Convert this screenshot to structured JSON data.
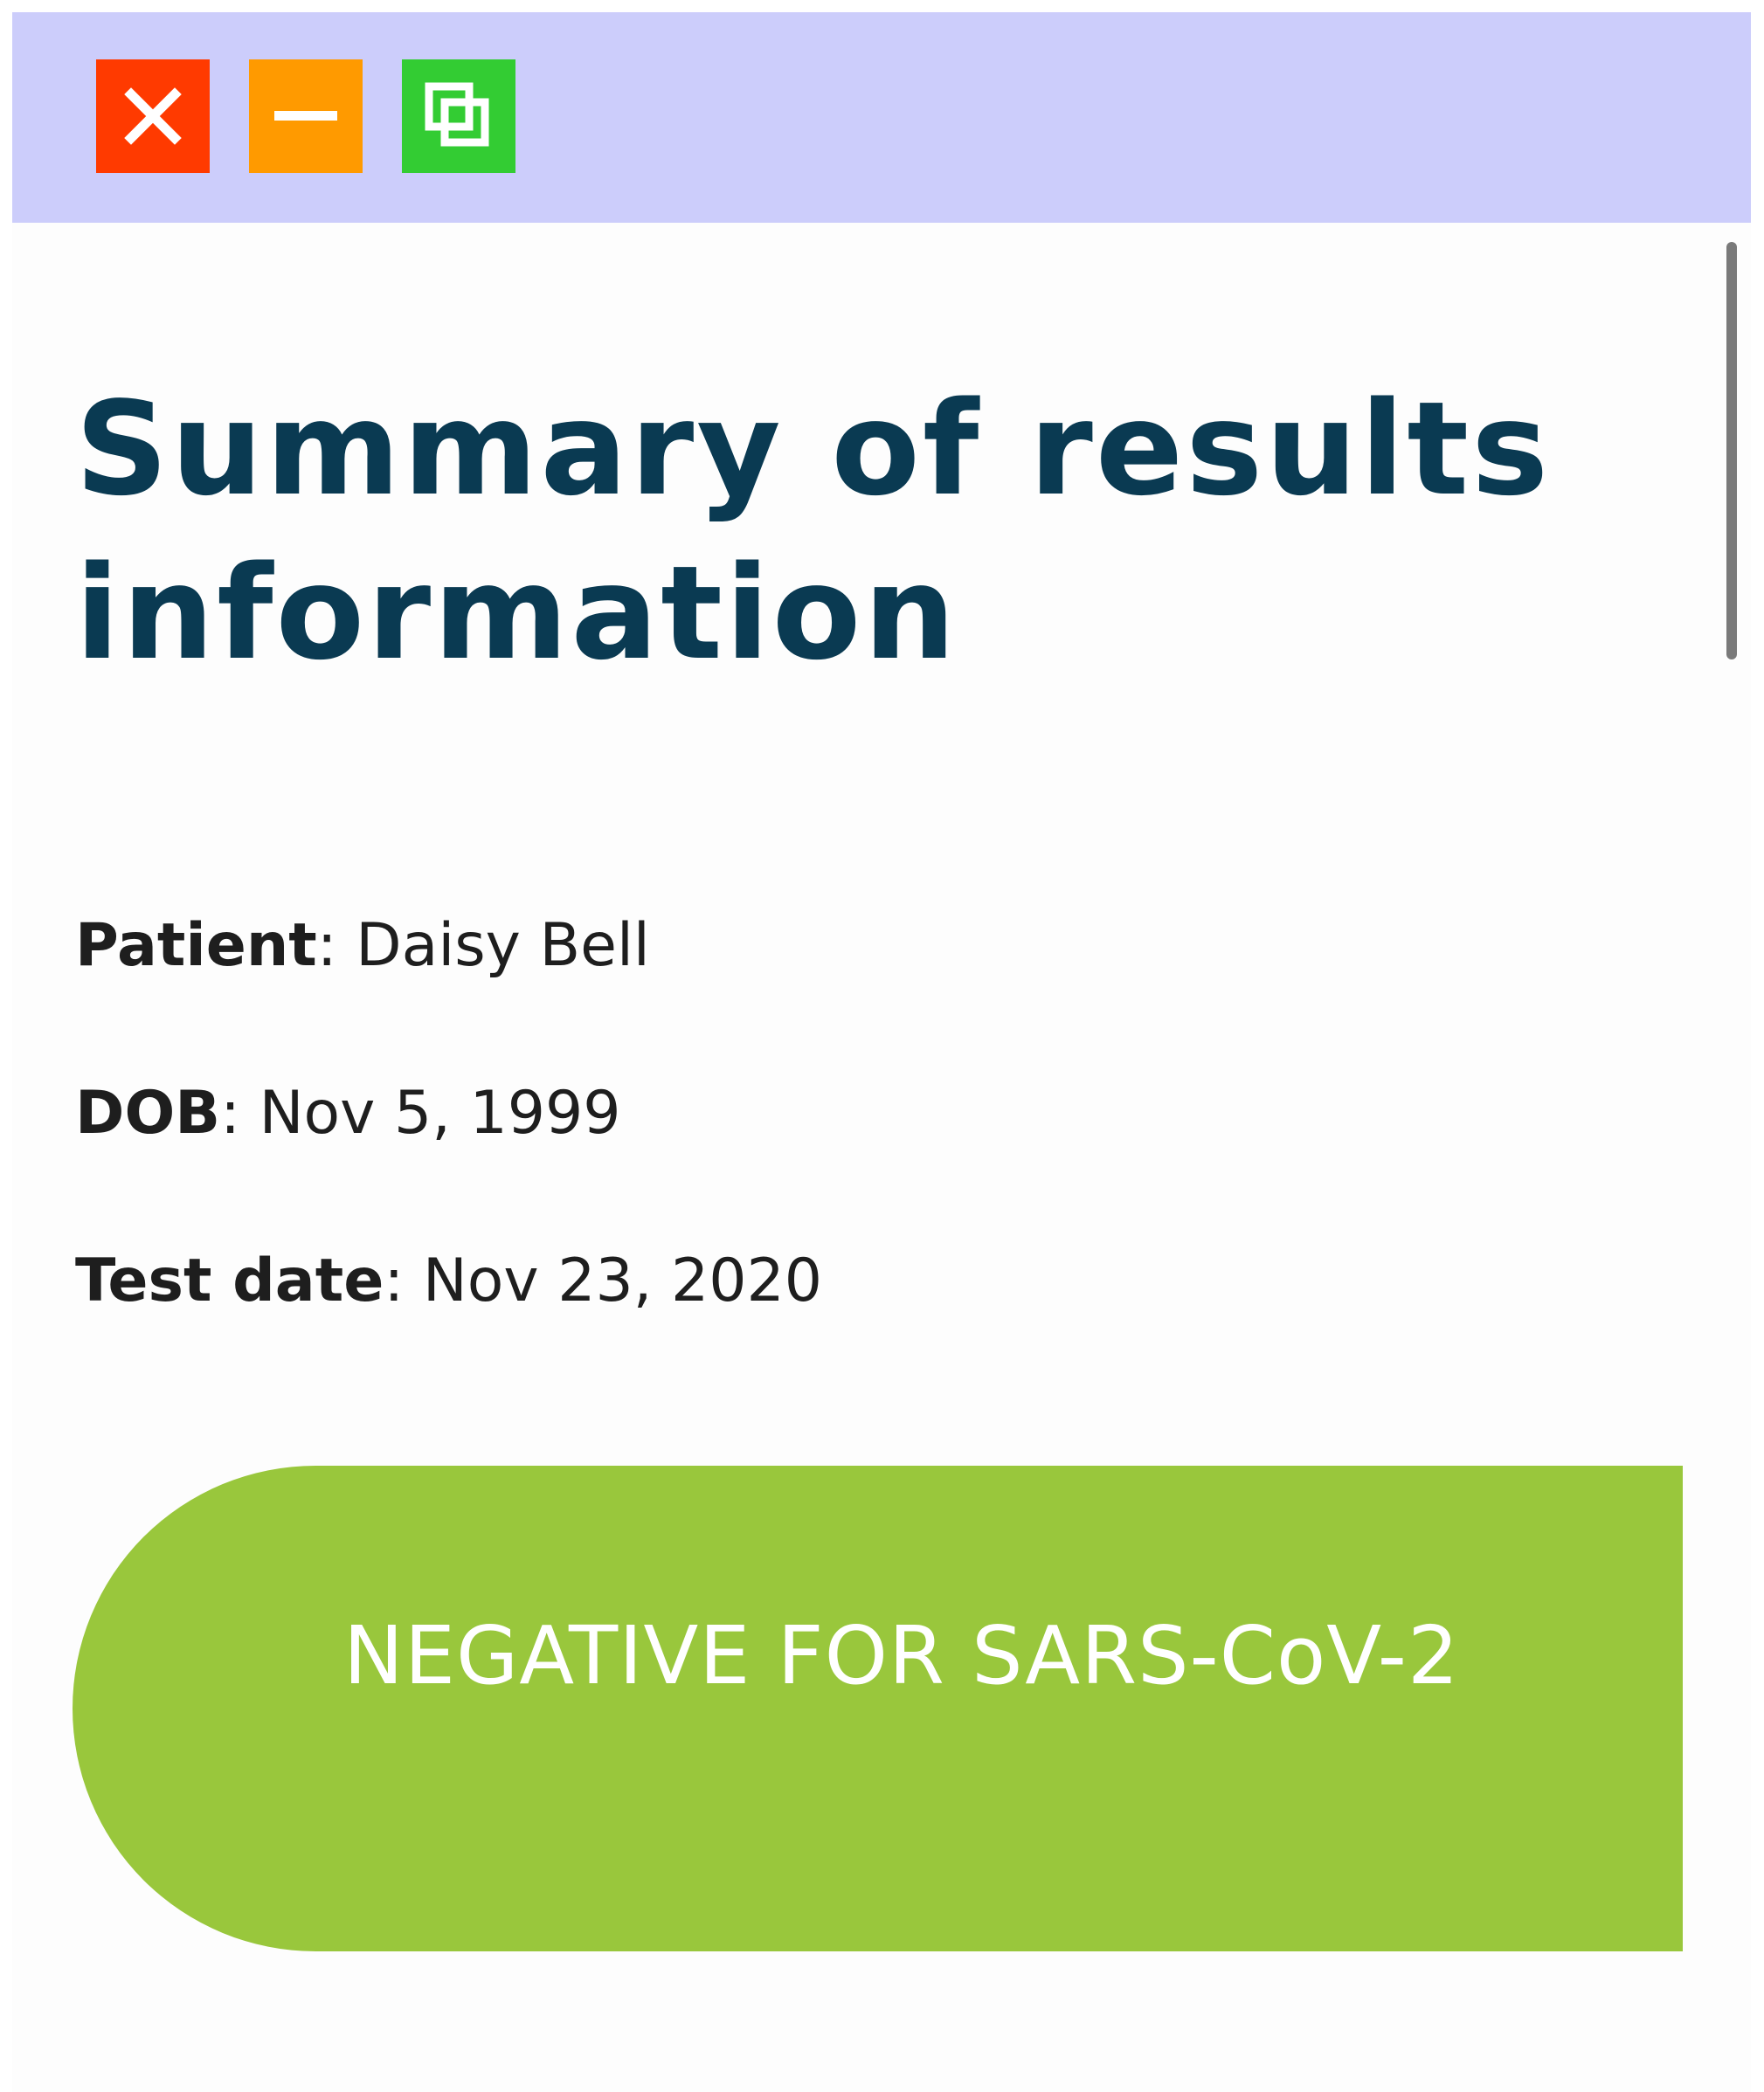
{
  "window": {
    "controls": {
      "close_icon": "close-icon",
      "minimize_icon": "minimize-icon",
      "maximize_icon": "maximize-icon"
    }
  },
  "page": {
    "title": "Summary of results information"
  },
  "patient": {
    "name_label": "Patient",
    "name": "Daisy Bell",
    "dob_label": "DOB",
    "dob": "Nov 5, 1999",
    "test_date_label": "Test date",
    "test_date": "Nov 23, 2020"
  },
  "result": {
    "text": "NEGATIVE FOR SARS-CoV-2"
  },
  "colors": {
    "titlebar": "#cccdfb",
    "close": "#ff3a00",
    "minimize": "#ff9a00",
    "maximize": "#33cc33",
    "title_text": "#0a3a52",
    "result_banner": "#99c73c"
  }
}
